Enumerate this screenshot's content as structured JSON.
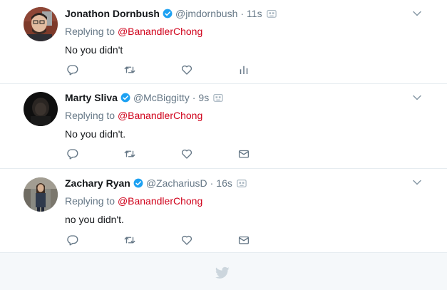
{
  "tweets": [
    {
      "name": "Jonathon Dornbush",
      "handle": "@jmdornbush",
      "time": "11s",
      "replying_prefix": "Replying to",
      "replying_to": "@BanandlerChong",
      "text": "No you didn't",
      "extra_action_icon": "analytics-icon"
    },
    {
      "name": "Marty Sliva",
      "handle": "@McBiggitty",
      "time": "9s",
      "replying_prefix": "Replying to",
      "replying_to": "@BanandlerChong",
      "text": "No you didn't.",
      "extra_action_icon": "direct-message-icon"
    },
    {
      "name": "Zachary Ryan",
      "handle": "@ZachariusD",
      "time": "16s",
      "replying_prefix": "Replying to",
      "replying_to": "@BanandlerChong",
      "text": "no you didn't.",
      "extra_action_icon": "direct-message-icon"
    }
  ],
  "separator": "·",
  "colors": {
    "name": "#14171a",
    "meta": "#657786",
    "mention": "#d0021b",
    "verified": "#1da1f2",
    "action_icon": "#657786",
    "divider": "#e6ecf0",
    "footer_bg": "#f5f8fa",
    "footer_bird": "#ccd6dd"
  },
  "footer": {
    "icon": "twitter-bird-icon"
  }
}
